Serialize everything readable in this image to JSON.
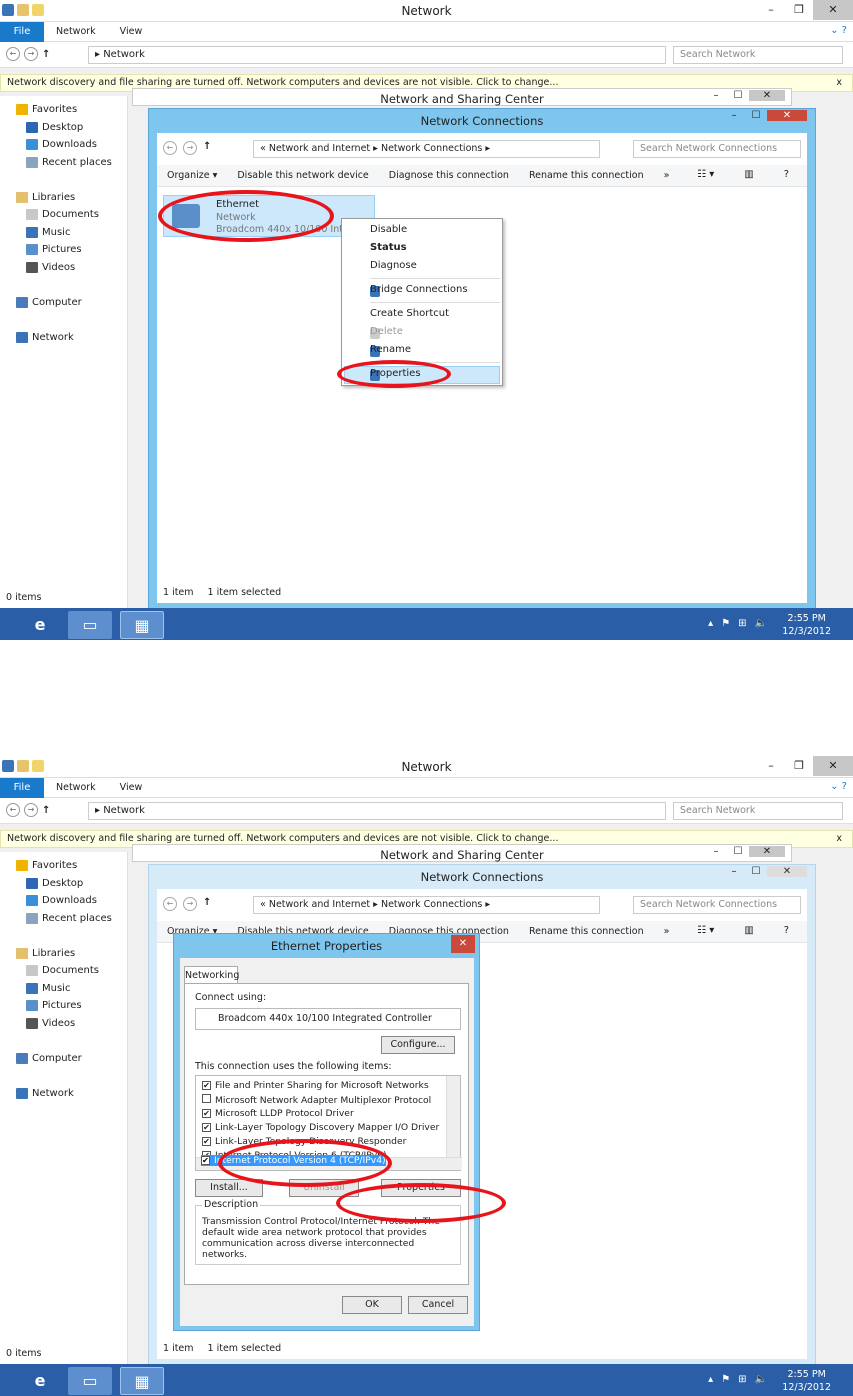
{
  "explorer": {
    "window_title": "Network",
    "ribbon_tabs": [
      "File",
      "Network",
      "View"
    ],
    "address_path": "Network",
    "search_placeholder": "Search Network",
    "infobar_text": "Network discovery and file sharing are turned off. Network computers and devices are not visible. Click to change...",
    "nav": {
      "favorites": "Favorites",
      "desktop": "Desktop",
      "downloads": "Downloads",
      "recent": "Recent places",
      "libraries": "Libraries",
      "documents": "Documents",
      "music": "Music",
      "pictures": "Pictures",
      "videos": "Videos",
      "computer": "Computer",
      "network": "Network"
    },
    "status_items": "0 items"
  },
  "sharing_center": {
    "title": "Network and Sharing Center"
  },
  "net_connections": {
    "title": "Network Connections",
    "breadcrumb_1": "Network and Internet",
    "breadcrumb_2": "Network Connections",
    "search_placeholder": "Search Network Connections",
    "commands": [
      "Organize ▾",
      "Disable this network device",
      "Diagnose this connection",
      "Rename this connection",
      "»"
    ],
    "adapter": {
      "name": "Ethernet",
      "network": "Network",
      "device": "Broadcom 440x 10/100 Integ..."
    },
    "status_count": "1 item",
    "status_selected": "1 item selected"
  },
  "context_menu": {
    "disable": "Disable",
    "status": "Status",
    "diagnose": "Diagnose",
    "bridge": "Bridge Connections",
    "shortcut": "Create Shortcut",
    "delete": "Delete",
    "rename": "Rename",
    "properties": "Properties"
  },
  "eth_dialog": {
    "title": "Ethernet Properties",
    "tab": "Networking",
    "connect_using": "Connect using:",
    "adapter": "Broadcom 440x 10/100 Integrated Controller",
    "configure": "Configure...",
    "items_label": "This connection uses the following items:",
    "items": [
      {
        "label": "File and Printer Sharing for Microsoft Networks",
        "checked": true
      },
      {
        "label": "Microsoft Network Adapter Multiplexor Protocol",
        "checked": false
      },
      {
        "label": "Microsoft LLDP Protocol Driver",
        "checked": true
      },
      {
        "label": "Link-Layer Topology Discovery Mapper I/O Driver",
        "checked": true
      },
      {
        "label": "Link-Layer Topology Discovery Responder",
        "checked": true
      },
      {
        "label": "Internet Protocol Version 6 (TCP/IPv6)",
        "checked": true
      },
      {
        "label": "Internet Protocol Version 4 (TCP/IPv4)",
        "checked": true
      }
    ],
    "install": "Install...",
    "uninstall": "Uninstall",
    "properties": "Properties",
    "description_label": "Description",
    "description": "Transmission Control Protocol/Internet Protocol. The default wide area network protocol that provides communication across diverse interconnected networks.",
    "ok": "OK",
    "cancel": "Cancel"
  },
  "taskbar": {
    "time": "2:55 PM",
    "date": "12/3/2012"
  }
}
